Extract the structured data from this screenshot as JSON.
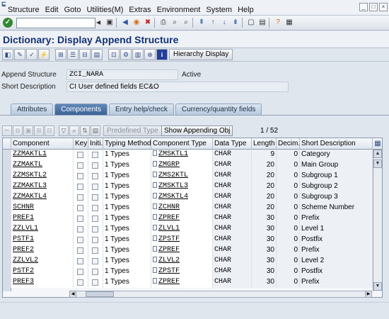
{
  "menu": [
    "Structure",
    "Edit",
    "Goto",
    "Utilities(M)",
    "Extras",
    "Environment",
    "System",
    "Help"
  ],
  "page_title": "Dictionary: Display Append Structure",
  "app_toolbar": {
    "hierarchy_display": "Hierarchy Display"
  },
  "header": {
    "append_structure_label": "Append Structure",
    "append_structure_value": "ZCI_NARA",
    "status": "Active",
    "short_description_label": "Short Description",
    "short_description_value": "CI User defined fields EC&O"
  },
  "tabs": [
    {
      "label": "Attributes",
      "active": false
    },
    {
      "label": "Components",
      "active": true
    },
    {
      "label": "Entry help/check",
      "active": false
    },
    {
      "label": "Currency/quantity fields",
      "active": false
    }
  ],
  "grid_toolbar": {
    "predefined_type": "Predefined Type",
    "show_appending_obj": "Show Appending Obj",
    "pager": "1 / 52"
  },
  "table": {
    "columns": [
      "Component",
      "Key",
      "Initi...",
      "Typing Method",
      "Component Type",
      "Data Type",
      "Length",
      "Decim...",
      "Short Description"
    ],
    "rows": [
      {
        "component": "ZZMAKTL1",
        "typing": "1 Types",
        "comp_type": "ZMSKTL1",
        "data_type": "CHAR",
        "length": "9",
        "decimals": "0",
        "description": "Category"
      },
      {
        "component": "ZZMAKTL",
        "typing": "1 Types",
        "comp_type": "ZMGRP",
        "data_type": "CHAR",
        "length": "20",
        "decimals": "0",
        "description": "Main Group"
      },
      {
        "component": "ZZMSKTL2",
        "typing": "1 Types",
        "comp_type": "ZMS2KTL",
        "data_type": "CHAR",
        "length": "20",
        "decimals": "0",
        "description": "Subgroup 1"
      },
      {
        "component": "ZZMAKTL3",
        "typing": "1 Types",
        "comp_type": "ZMSKTL3",
        "data_type": "CHAR",
        "length": "20",
        "decimals": "0",
        "description": "Subgroup 2"
      },
      {
        "component": "ZZMAKTL4",
        "typing": "1 Types",
        "comp_type": "ZMSKTL4",
        "data_type": "CHAR",
        "length": "20",
        "decimals": "0",
        "description": "Subgroup 3"
      },
      {
        "component": "SCHNR",
        "typing": "1 Types",
        "comp_type": "ZCHNR",
        "data_type": "CHAR",
        "length": "20",
        "decimals": "0",
        "description": "Scheme Number"
      },
      {
        "component": "PREF1",
        "typing": "1 Types",
        "comp_type": "ZPREF",
        "data_type": "CHAR",
        "length": "30",
        "decimals": "0",
        "description": "Prefix"
      },
      {
        "component": "ZZLVL1",
        "typing": "1 Types",
        "comp_type": "ZLVL1",
        "data_type": "CHAR",
        "length": "30",
        "decimals": "0",
        "description": "Level 1"
      },
      {
        "component": "PSTF1",
        "typing": "1 Types",
        "comp_type": "ZPSTF",
        "data_type": "CHAR",
        "length": "30",
        "decimals": "0",
        "description": "Postfix"
      },
      {
        "component": "PREF2",
        "typing": "1 Types",
        "comp_type": "ZPREF",
        "data_type": "CHAR",
        "length": "30",
        "decimals": "0",
        "description": "Prefix"
      },
      {
        "component": "ZZLVL2",
        "typing": "1 Types",
        "comp_type": "ZLVL2",
        "data_type": "CHAR",
        "length": "30",
        "decimals": "0",
        "description": "Level 2"
      },
      {
        "component": "PSTF2",
        "typing": "1 Types",
        "comp_type": "ZPSTF",
        "data_type": "CHAR",
        "length": "30",
        "decimals": "0",
        "description": "Postfix"
      },
      {
        "component": "PREF3",
        "typing": "1 Types",
        "comp_type": "ZPREF",
        "data_type": "CHAR",
        "length": "30",
        "decimals": "0",
        "description": "Prefix"
      }
    ]
  },
  "colors": {
    "title": "#14317a",
    "active_tab": "#3d6397",
    "background": "#dfe6ee"
  }
}
